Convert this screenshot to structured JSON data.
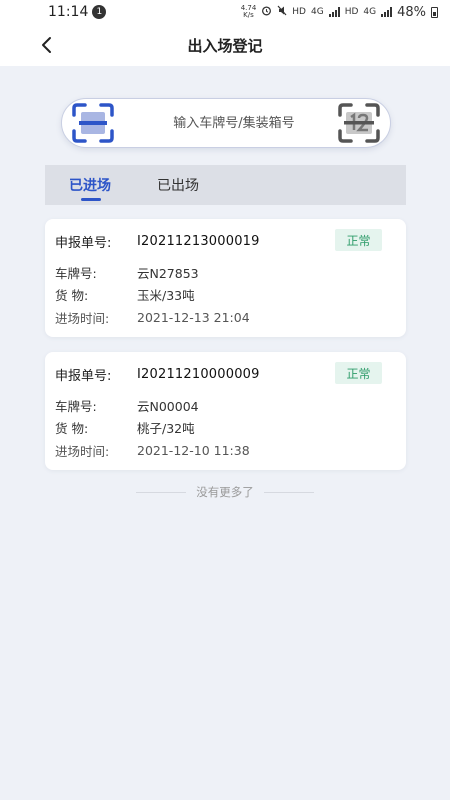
{
  "status_bar": {
    "time": "11:14",
    "notification_count": "1",
    "net_speed": "4.74\nK/s",
    "network_labels": [
      "HD",
      "4G",
      "HD",
      "4G"
    ],
    "battery": "48%"
  },
  "header": {
    "title": "出入场登记"
  },
  "search": {
    "placeholder": "输入车牌号/集装箱号"
  },
  "tabs": [
    {
      "label": "已进场",
      "active": true
    },
    {
      "label": "已出场",
      "active": false
    }
  ],
  "labels": {
    "declare_no": "申报单号:",
    "plate": "车牌号:",
    "cargo": "货 物:",
    "entry_time": "进场时间:"
  },
  "records": [
    {
      "declare_no": "I20211213000019",
      "status": "正常",
      "plate": "云N27853",
      "cargo": "玉米/33吨",
      "entry_time": "2021-12-13 21:04"
    },
    {
      "declare_no": "I20211210000009",
      "status": "正常",
      "plate": "云N00004",
      "cargo": "桃子/32吨",
      "entry_time": "2021-12-10 11:38"
    }
  ],
  "footer": {
    "no_more": "没有更多了"
  },
  "colors": {
    "accent": "#2d55c8",
    "status_ok_text": "#2e9c6a",
    "status_ok_bg": "#e5f4ee",
    "page_bg": "#eef1f7"
  },
  "icons": {
    "back": "chevron-left-icon",
    "scan_left": "scan-icon",
    "scan_right": "plate-recognition-icon"
  }
}
